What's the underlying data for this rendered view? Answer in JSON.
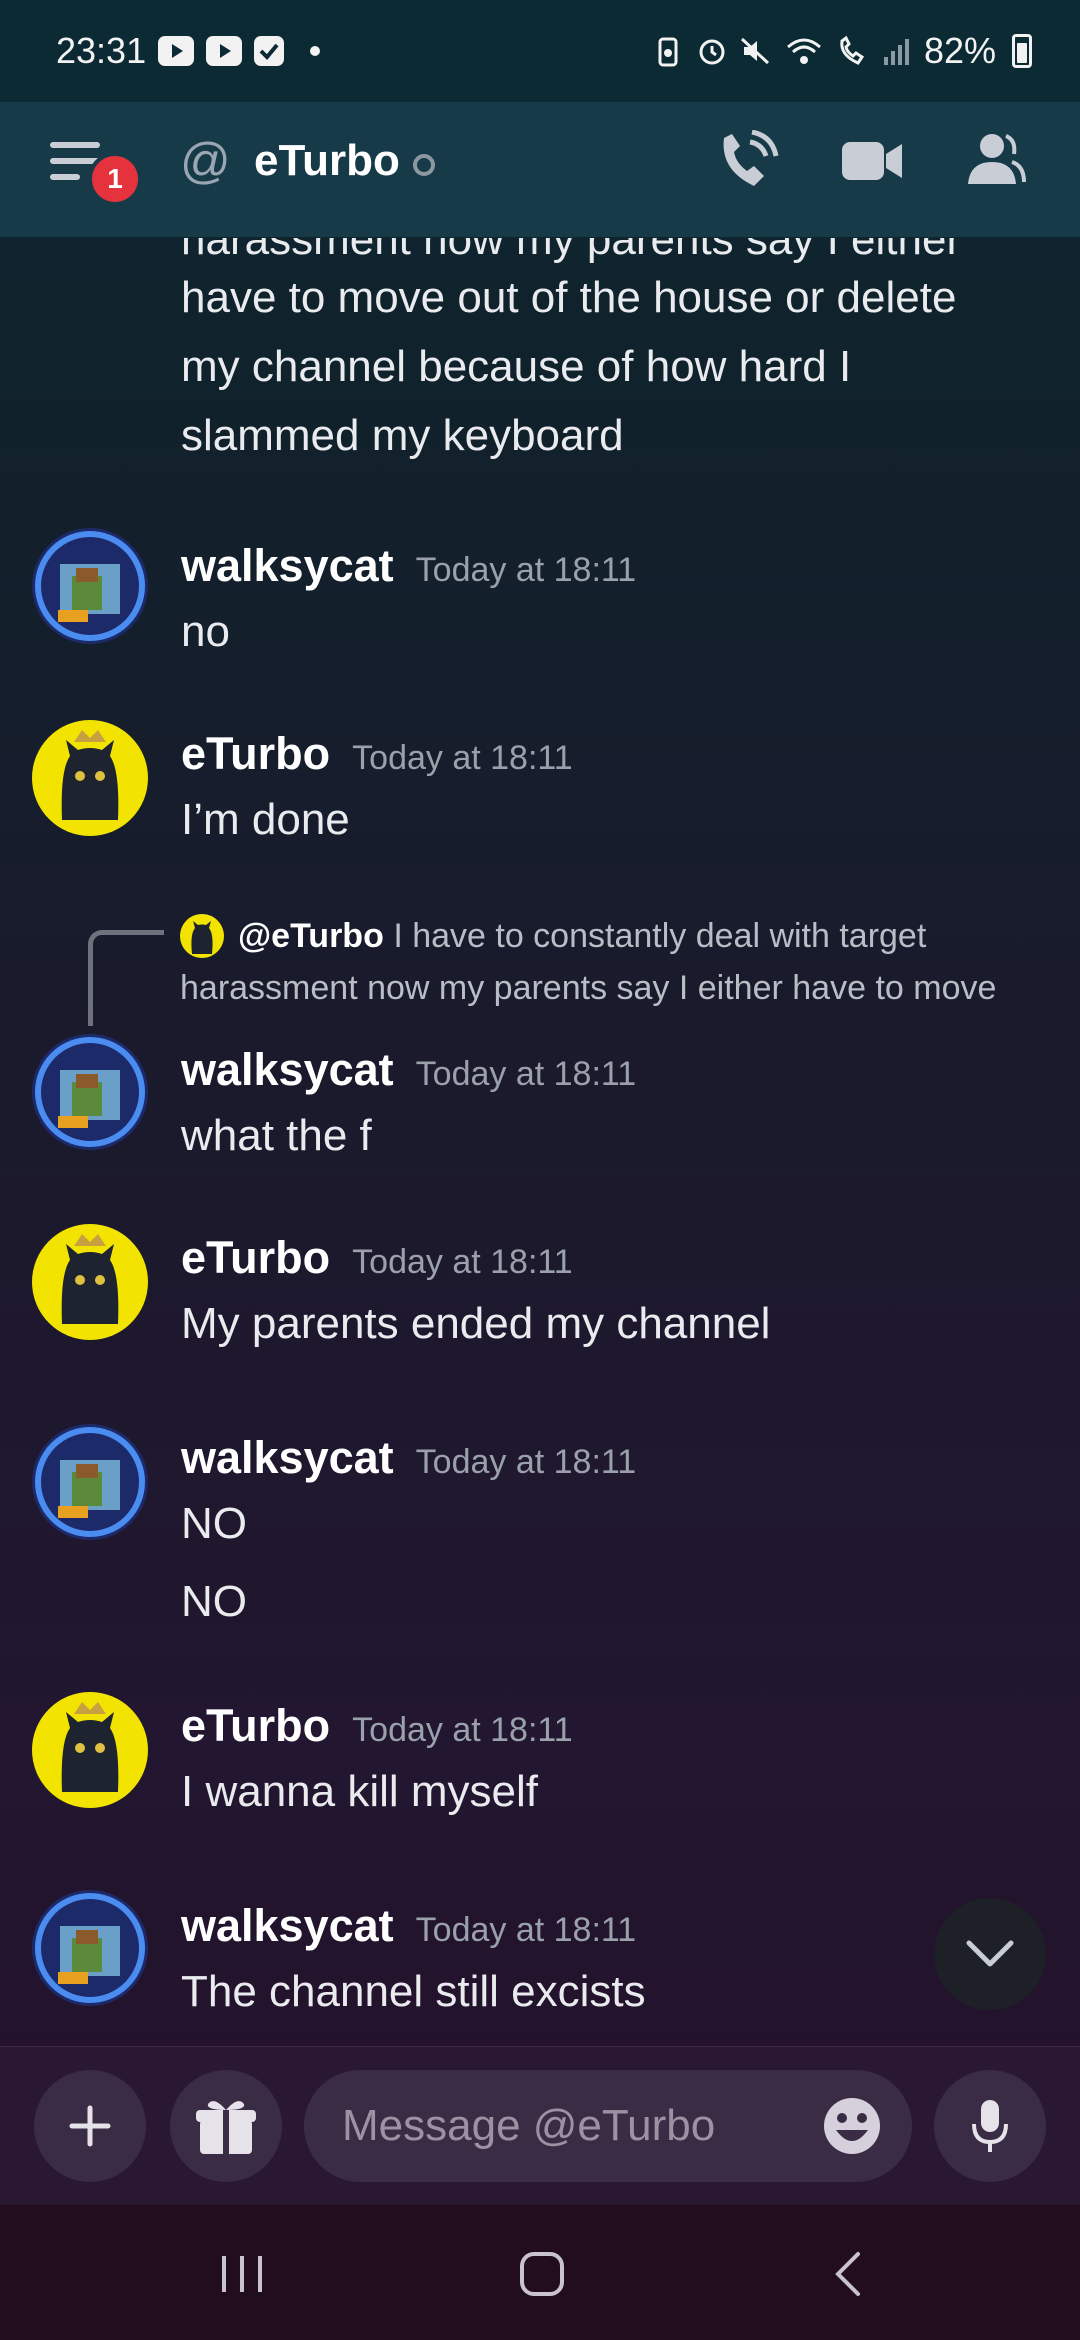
{
  "status_bar": {
    "time": "23:31",
    "battery": "82%"
  },
  "header": {
    "menu_badge": "1",
    "title": "eTurbo"
  },
  "messages": [
    {
      "type": "continuation",
      "lines": [
        "harassment now my parents say I either",
        "have to move out of the house or delete",
        "my channel because of how hard I",
        "slammed my keyboard"
      ]
    },
    {
      "author": "walksycat",
      "time": "Today at 18:11",
      "lines": [
        "no"
      ]
    },
    {
      "author": "eTurbo",
      "time": "Today at 18:11",
      "lines": [
        "I’m done"
      ]
    },
    {
      "author": "walksycat",
      "time": "Today at 18:11",
      "lines": [
        "what the f"
      ],
      "reply": {
        "name": "@eTurbo",
        "text_line1": "I have to constantly deal with target",
        "text_line2": "harassment now my parents say I either have to move"
      }
    },
    {
      "author": "eTurbo",
      "time": "Today at 18:11",
      "lines": [
        "My parents ended my channel"
      ]
    },
    {
      "author": "walksycat",
      "time": "Today at 18:11",
      "lines": [
        "NO",
        "NO"
      ]
    },
    {
      "author": "eTurbo",
      "time": "Today at 18:11",
      "lines": [
        "I wanna kill myself"
      ]
    },
    {
      "author": "walksycat",
      "time": "Today at 18:11",
      "lines": [
        "The channel still excists"
      ]
    }
  ],
  "composer": {
    "placeholder": "Message @eTurbo"
  },
  "colors": {
    "accent_red": "#e4333d",
    "header_bg": "#173a48",
    "avatar_yellow": "#f2e400"
  }
}
